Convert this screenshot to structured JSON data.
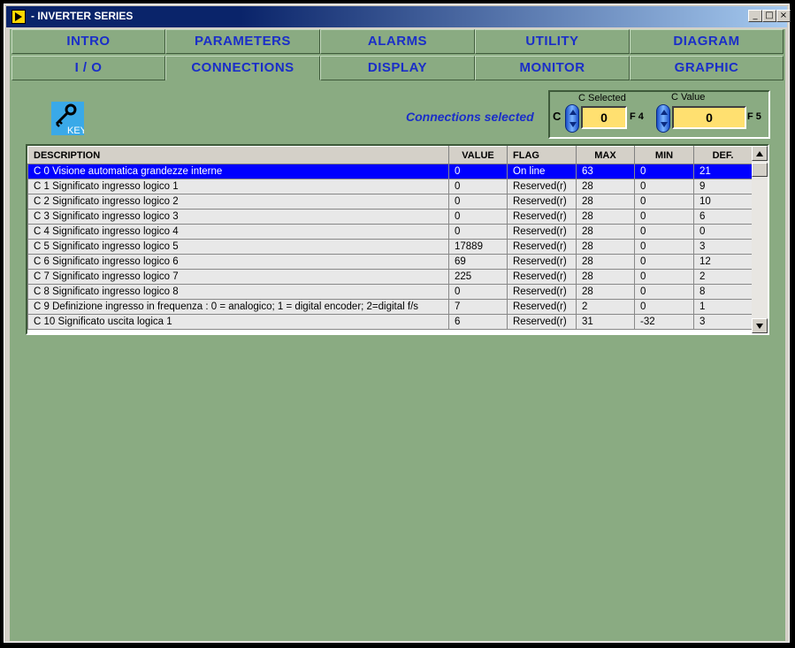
{
  "window": {
    "title": "- INVERTER SERIES",
    "minimize": "_",
    "maximize": "□",
    "close": "×"
  },
  "tabs_row1": [
    "INTRO",
    "PARAMETERS",
    "ALARMS",
    "UTILITY",
    "DIAGRAM"
  ],
  "tabs_row2": [
    "I / O",
    "CONNECTIONS",
    "DISPLAY",
    "MONITOR",
    "GRAPHIC"
  ],
  "active_tab": "CONNECTIONS",
  "key_label": "KEY",
  "connections_label": "Connections selected",
  "c_selector": {
    "selected_label": "C Selected",
    "value_label": "C Value",
    "prefix": "C",
    "selected_value": "0",
    "value": "0",
    "fkey_selected": "F 4",
    "fkey_value": "F 5"
  },
  "table": {
    "headers": [
      "DESCRIPTION",
      "VALUE",
      "FLAG",
      "MAX",
      "MIN",
      "DEF."
    ],
    "rows": [
      [
        "C 0   Visione automatica grandezze interne",
        "0",
        "On line",
        "63",
        "0",
        "21"
      ],
      [
        "C 1   Significato ingresso logico 1",
        "0",
        "Reserved(r)",
        "28",
        "0",
        "9"
      ],
      [
        "C 2   Significato ingresso logico 2",
        "0",
        "Reserved(r)",
        "28",
        "0",
        "10"
      ],
      [
        "C 3   Significato ingresso logico 3",
        "0",
        "Reserved(r)",
        "28",
        "0",
        "6"
      ],
      [
        "C 4   Significato ingresso logico 4",
        "0",
        "Reserved(r)",
        "28",
        "0",
        "0"
      ],
      [
        "C 5   Significato ingresso logico 5",
        "17889",
        "Reserved(r)",
        "28",
        "0",
        "3"
      ],
      [
        "C 6   Significato ingresso logico 6",
        "69",
        "Reserved(r)",
        "28",
        "0",
        "12"
      ],
      [
        "C 7   Significato ingresso logico 7",
        "225",
        "Reserved(r)",
        "28",
        "0",
        "2"
      ],
      [
        "C 8   Significato ingresso logico 8",
        "0",
        "Reserved(r)",
        "28",
        "0",
        "8"
      ],
      [
        "C 9   Definizione ingresso in frequenza : 0 = analogico;  1 = digital encoder;  2=digital f/s",
        "7",
        "Reserved(r)",
        "2",
        "0",
        "1"
      ],
      [
        "C 10   Significato uscita logica 1",
        "6",
        "Reserved(r)",
        "31",
        "-32",
        "3"
      ]
    ]
  },
  "colors": {
    "background": "#8aab82",
    "tab_text": "#1a2ec8",
    "selection": "#0000ff",
    "value_box": "#ffe070"
  }
}
